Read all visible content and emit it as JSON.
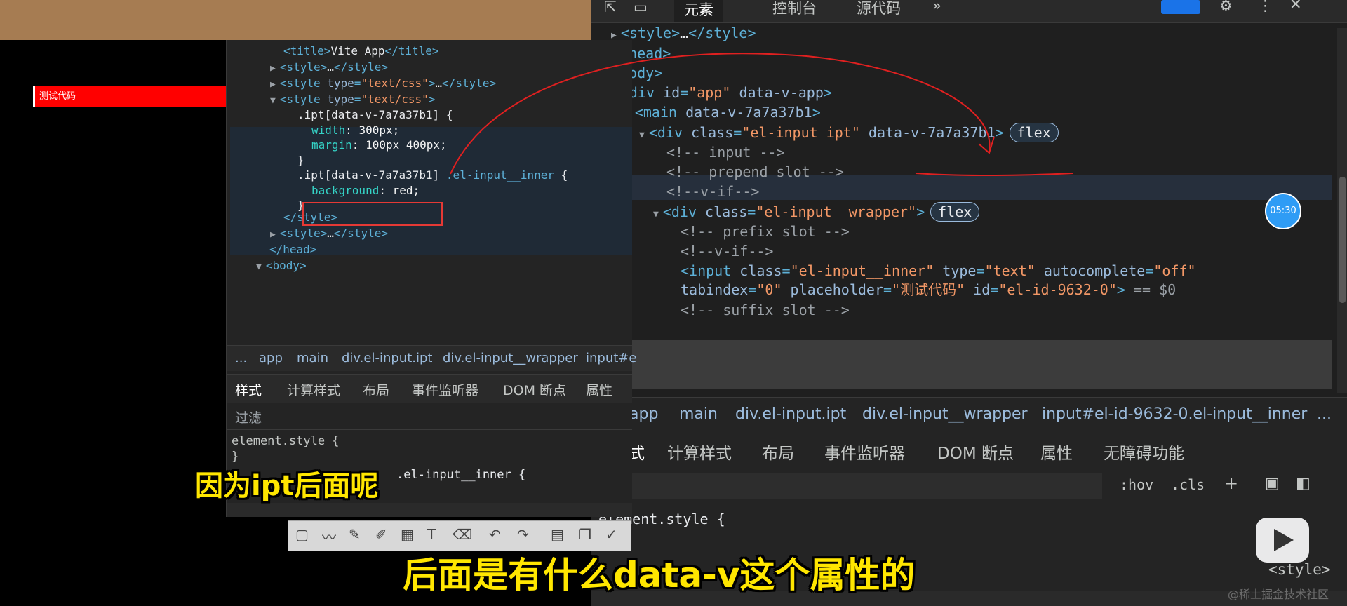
{
  "preview": {
    "input_placeholder": "测试代码"
  },
  "small_devtools": {
    "tree": [
      {
        "indent": 62,
        "open": "",
        "parts": [
          [
            "tag",
            "<title>"
          ],
          [
            "txt",
            "Vite App"
          ],
          [
            "tag",
            "</title>"
          ]
        ]
      },
      {
        "indent": 62,
        "open": "▶",
        "parts": [
          [
            "tag",
            "<style>"
          ],
          [
            "txt",
            "…"
          ],
          [
            "tag",
            "</style>"
          ]
        ]
      },
      {
        "indent": 62,
        "open": "▶",
        "parts": [
          [
            "tag",
            "<style "
          ],
          [
            "attr",
            "type"
          ],
          [
            "tag",
            "="
          ],
          [
            "val",
            "\"text/css\""
          ],
          [
            "tag",
            ">"
          ],
          [
            "txt",
            "…"
          ],
          [
            "tag",
            "</style>"
          ]
        ]
      },
      {
        "indent": 62,
        "open": "▼",
        "parts": [
          [
            "tag",
            "<style "
          ],
          [
            "attr",
            "type"
          ],
          [
            "tag",
            "="
          ],
          [
            "val",
            "\"text/css\""
          ],
          [
            "tag",
            ">"
          ]
        ]
      }
    ],
    "css_lines": [
      {
        "indent": 82,
        "parts": [
          [
            "sel",
            ".ipt[data-v-7a7a37b1] {"
          ]
        ]
      },
      {
        "indent": 102,
        "parts": [
          [
            "prop",
            "width"
          ],
          [
            "pval",
            ": 300px;"
          ]
        ]
      },
      {
        "indent": 102,
        "parts": [
          [
            "prop",
            "margin"
          ],
          [
            "pval",
            ": 100px 400px;"
          ]
        ]
      },
      {
        "indent": 82,
        "parts": [
          [
            "sel",
            "}"
          ]
        ]
      },
      {
        "indent": 82,
        "parts": [
          [
            "sel",
            ".ipt[data-v-7a7a37b1] "
          ],
          [
            "tag",
            ".el-input__inner"
          ],
          [
            "sel",
            " {"
          ]
        ]
      },
      {
        "indent": 102,
        "parts": [
          [
            "prop",
            "background"
          ],
          [
            "pval",
            ": red;"
          ]
        ]
      },
      {
        "indent": 82,
        "parts": [
          [
            "sel",
            "}"
          ]
        ]
      }
    ],
    "tree_after": [
      {
        "indent": 62,
        "open": "",
        "parts": [
          [
            "tag",
            "</style>"
          ]
        ]
      },
      {
        "indent": 62,
        "open": "▶",
        "parts": [
          [
            "tag",
            "<style>"
          ],
          [
            "txt",
            "…"
          ],
          [
            "tag",
            "</style>"
          ]
        ]
      },
      {
        "indent": 42,
        "open": "",
        "parts": [
          [
            "tag",
            "</head>"
          ]
        ]
      },
      {
        "indent": 42,
        "open": "▼",
        "parts": [
          [
            "tag",
            "<body>"
          ]
        ]
      }
    ],
    "breadcrumbs": [
      "...",
      "app",
      "main",
      "div.el-input.ipt",
      "div.el-input__wrapper",
      "input#e"
    ],
    "tabs": [
      "样式",
      "计算样式",
      "布局",
      "事件监听器",
      "DOM 断点",
      "属性"
    ],
    "filter_label": "过滤",
    "element_style": "element.style {",
    "element_style_close": "}",
    "rule_selector": ".el-input__inner {"
  },
  "main_devtools": {
    "top_tabs": [
      "元素",
      "控制台",
      "源代码"
    ],
    "more": "»",
    "tree": [
      {
        "indent": 18,
        "open": "▶",
        "parts": [
          [
            "tag",
            "<style>"
          ],
          [
            "txt",
            "…"
          ],
          [
            "tag",
            "</style>"
          ]
        ]
      },
      {
        "indent": 0,
        "open": "",
        "parts": [
          [
            "tag",
            "</head>"
          ]
        ]
      },
      {
        "indent": 0,
        "open": "",
        "parts": [
          [
            "tag",
            "<body>"
          ]
        ]
      },
      {
        "indent": 18,
        "open": "▼",
        "parts": [
          [
            "tag",
            "<div "
          ],
          [
            "attr",
            "id"
          ],
          [
            "tag",
            "="
          ],
          [
            "val",
            "\"app\""
          ],
          [
            "attr",
            " data-v-app"
          ],
          [
            "tag",
            ">"
          ]
        ]
      },
      {
        "indent": 38,
        "open": "▼",
        "parts": [
          [
            "tag",
            "<main "
          ],
          [
            "attr",
            "data-v-7a7a37b1"
          ],
          [
            "tag",
            ">"
          ]
        ]
      },
      {
        "indent": 58,
        "open": "▼",
        "parts": [
          [
            "tag",
            "<div "
          ],
          [
            "attr",
            "class"
          ],
          [
            "tag",
            "="
          ],
          [
            "val",
            "\"el-input ipt\""
          ],
          [
            "attr",
            " data-v-7a7a37b1"
          ],
          [
            "tag",
            ">"
          ]
        ],
        "badge": "flex"
      },
      {
        "indent": 78,
        "open": "",
        "parts": [
          [
            "cmt",
            "<!-- input -->"
          ]
        ]
      },
      {
        "indent": 78,
        "open": "",
        "parts": [
          [
            "cmt",
            "<!-- prepend slot -->"
          ]
        ]
      },
      {
        "indent": 78,
        "open": "",
        "parts": [
          [
            "cmt",
            "<!--v-if-->"
          ]
        ]
      },
      {
        "indent": 78,
        "open": "▼",
        "parts": [
          [
            "tag",
            "<div "
          ],
          [
            "attr",
            "class"
          ],
          [
            "tag",
            "="
          ],
          [
            "val",
            "\"el-input__wrapper\""
          ],
          [
            "tag",
            ">"
          ]
        ],
        "badge": "flex"
      },
      {
        "indent": 98,
        "open": "",
        "parts": [
          [
            "cmt",
            "<!-- prefix slot -->"
          ]
        ]
      },
      {
        "indent": 98,
        "open": "",
        "parts": [
          [
            "cmt",
            "<!--v-if-->"
          ]
        ]
      },
      {
        "indent": 98,
        "open": "",
        "parts": [
          [
            "tag",
            "<input "
          ],
          [
            "attr",
            "class"
          ],
          [
            "tag",
            "="
          ],
          [
            "val",
            "\"el-input__inner\""
          ],
          [
            "attr",
            " type"
          ],
          [
            "tag",
            "="
          ],
          [
            "val",
            "\"text\""
          ],
          [
            "attr",
            " autocomplete"
          ],
          [
            "tag",
            "="
          ],
          [
            "val",
            "\"off\""
          ]
        ]
      },
      {
        "indent": 98,
        "open": "",
        "parts": [
          [
            "attr",
            "tabindex"
          ],
          [
            "tag",
            "="
          ],
          [
            "val",
            "\"0\""
          ],
          [
            "attr",
            " placeholder"
          ],
          [
            "tag",
            "="
          ],
          [
            "val",
            "\"测试代码\""
          ],
          [
            "attr",
            " id"
          ],
          [
            "tag",
            "="
          ],
          [
            "val",
            "\"el-id-9632-0\""
          ],
          [
            "tag",
            ">"
          ],
          [
            "cmt",
            " == $0"
          ]
        ]
      },
      {
        "indent": 98,
        "open": "",
        "parts": [
          [
            "cmt",
            "<!-- suffix slot -->"
          ]
        ]
      }
    ],
    "breadcrumbs": [
      "app",
      "main",
      "div.el-input.ipt",
      "div.el-input__wrapper",
      "input#el-id-9632-0.el-input__inner",
      "..."
    ],
    "tabs": [
      "式",
      "计算样式",
      "布局",
      "事件监听器",
      "DOM 断点",
      "属性",
      "无障碍功能"
    ],
    "filter_tools": [
      ":hov",
      ".cls",
      "+"
    ],
    "element_style": "element.style {",
    "element_style_close": "}",
    "style_tag": "<style>",
    "timer": "05:30"
  },
  "subtitles": {
    "line1": "因为ipt后面呢",
    "line2": "后面是有什么data-v这个属性的"
  },
  "watermark": "@稀土掘金技术社区"
}
